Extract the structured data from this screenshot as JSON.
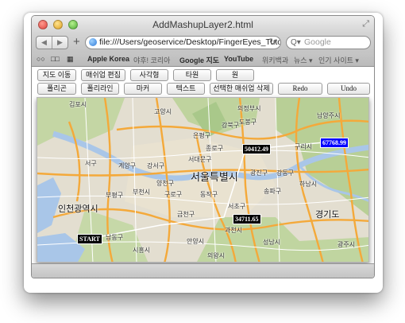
{
  "window": {
    "title": "AddMashupLayer2.html",
    "url": "file:///Users/geoservice/Desktop/FingerEyes_Tuto",
    "search_placeholder": "Google"
  },
  "bookmarks": [
    "Apple Korea",
    "야후! 코리아",
    "Google 지도",
    "YouTube",
    "위키백과",
    "뉴스 ▾",
    "인기 사이트 ▾"
  ],
  "buttons_row1": [
    "지도 이동",
    "매쉬업 편집",
    "사각형",
    "타원",
    "원"
  ],
  "buttons_row2": [
    "폴리곤",
    "폴리라인",
    "마커",
    "텍스트",
    "선택한 매쉬업 삭제",
    "Redo",
    "Undo"
  ],
  "map": {
    "labels": {
      "seoul": "서울특별시",
      "incheon": "인천광역시",
      "gyeonggi": "경기도",
      "gimpo": "김포시",
      "goyang": "고양시",
      "uijeongbu": "의정부시",
      "namyangju": "남양주시",
      "gangbuk": "강북구",
      "dobong": "도봉구",
      "eunpyeong": "은평구",
      "jongno": "종로구",
      "guri": "구리시",
      "seodaemun": "서대문구",
      "gwangjin": "광진구",
      "gangdong": "강동구",
      "gyeyang": "계양구",
      "gangseo": "강서구",
      "seogu": "서구",
      "yangcheon": "양천구",
      "guro": "구로구",
      "dongjak": "동작구",
      "songpa": "송파구",
      "hanam": "하남시",
      "bupyeong": "부평구",
      "bucheon": "부천시",
      "geumcheon": "금천구",
      "seocho": "서초구",
      "gwacheon": "과천시",
      "namdong": "남동구",
      "siheung": "시흥시",
      "anyang": "안양시",
      "uiwang": "의왕시",
      "seongnam": "성남시",
      "gwangju": "광주시"
    },
    "measurements": [
      "50412.49",
      "67768.99",
      "34711.65"
    ],
    "start_label": "START",
    "colors": {
      "road_major": "#f4a93a",
      "road_minor": "#ffffff",
      "water": "#a9c6e8",
      "green": "#bcd29d",
      "urban": "#e6e1d2",
      "measure_line": "#ffffff"
    }
  }
}
